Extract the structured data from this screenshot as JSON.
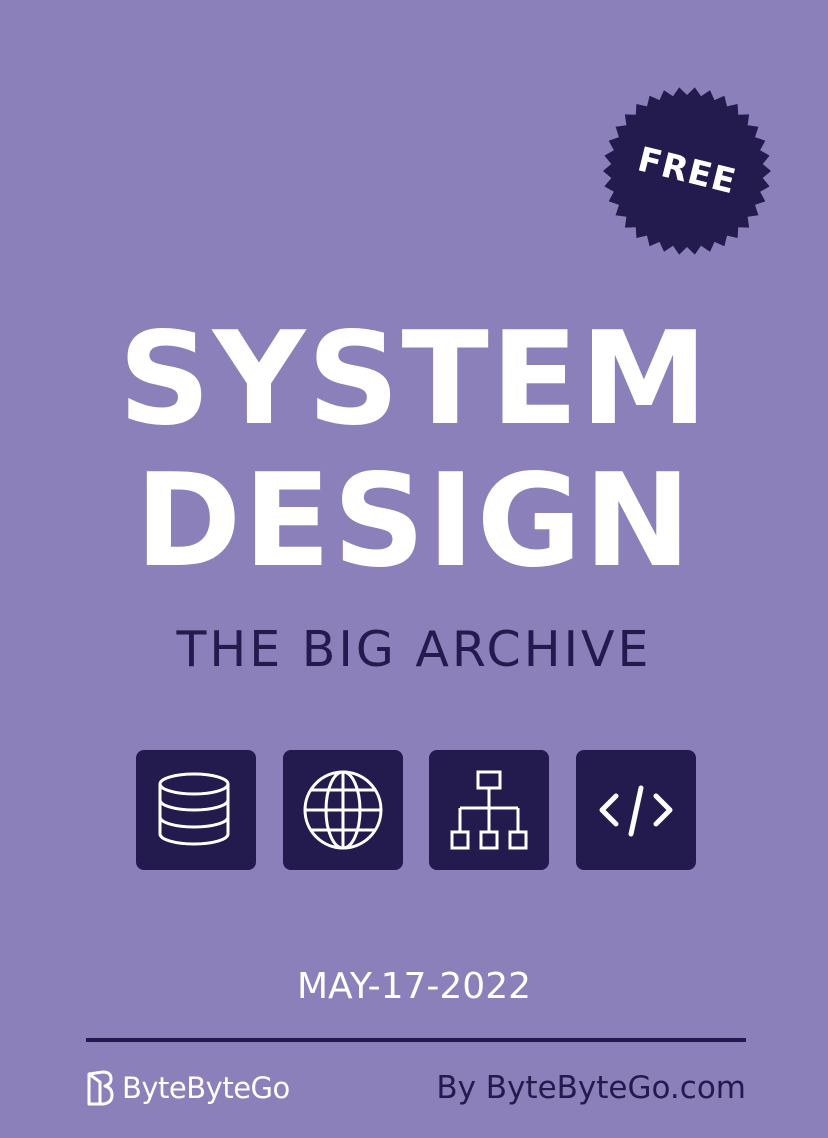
{
  "cover": {
    "badge": {
      "label": "FREE"
    },
    "title": {
      "line1": "SYSTEM",
      "line2": "DESIGN"
    },
    "subtitle": "THE BIG ARCHIVE",
    "icons": [
      "database-icon",
      "globe-icon",
      "hierarchy-icon",
      "code-icon"
    ],
    "date": "MAY-17-2022",
    "brand": {
      "name": "ByteByteGo",
      "logo": "bytebytego-logo"
    },
    "credit": "By ByteByteGo.com"
  },
  "colors": {
    "background": "#8b80ba",
    "dark": "#231a4d",
    "text_light": "#ffffff"
  }
}
